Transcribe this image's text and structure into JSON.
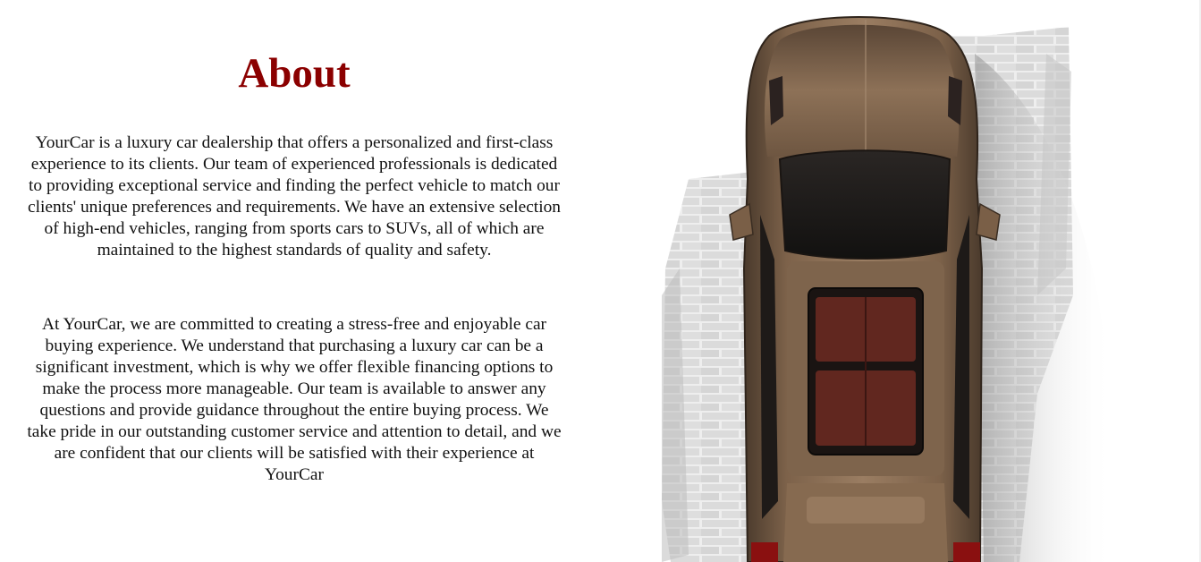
{
  "about": {
    "title": "About",
    "paragraphs": [
      "YourCar is a luxury car dealership that offers a personalized and first-class experience to its clients. Our team of experienced professionals is dedicated to providing exceptional service and finding the perfect vehicle to match our clients' unique preferences and requirements. We have an extensive selection of high-end vehicles, ranging from sports cars to SUVs, all of which are maintained to the highest standards of quality and safety.",
      "At YourCar, we are committed to creating a stress-free and enjoyable car buying experience. We understand that purchasing a luxury car can be a significant investment, which is why we offer flexible financing options to make the process more manageable. Our team is available to answer any questions and provide guidance throughout the entire buying process. We take pride in our outstanding customer service and attention to detail, and we are confident that our clients will be satisfied with their experience at YourCar"
    ]
  },
  "image": {
    "subject": "top-down-brown-suv-on-brick-wall",
    "colors": {
      "title": "#8b0000",
      "car_body": "#7a5f47",
      "interior": "#6e2a22",
      "wall": "#d9d9d9"
    }
  }
}
